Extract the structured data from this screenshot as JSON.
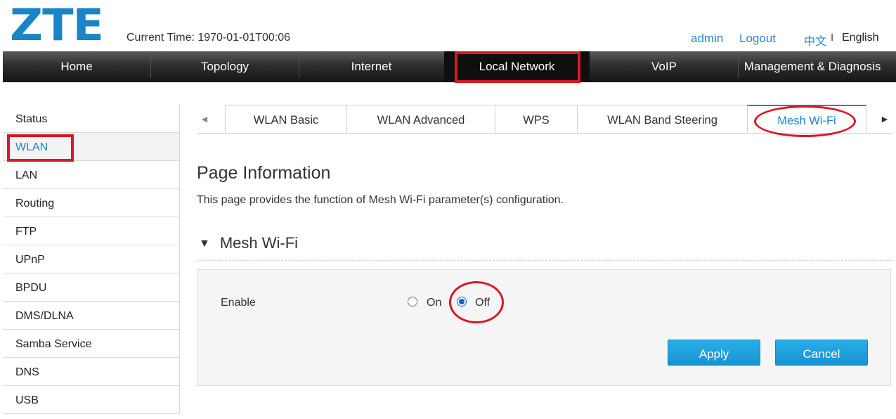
{
  "brand": {
    "logo": "ZTE",
    "color": "#1a84c7"
  },
  "header": {
    "current_time": "Current Time: 1970-01-01T00:06",
    "user": "admin",
    "logout": "Logout",
    "lang_cn": "中文",
    "lang_sep": "I",
    "lang_en": "English"
  },
  "nav": {
    "items": [
      {
        "label": "Home"
      },
      {
        "label": "Topology"
      },
      {
        "label": "Internet"
      },
      {
        "label": "Local Network",
        "active": true
      },
      {
        "label": "VoIP"
      },
      {
        "label": "Management & Diagnosis"
      }
    ]
  },
  "sidebar": {
    "items": [
      {
        "label": "Status"
      },
      {
        "label": "WLAN",
        "active": true
      },
      {
        "label": "LAN"
      },
      {
        "label": "Routing"
      },
      {
        "label": "FTP"
      },
      {
        "label": "UPnP"
      },
      {
        "label": "BPDU"
      },
      {
        "label": "DMS/DLNA"
      },
      {
        "label": "Samba Service"
      },
      {
        "label": "DNS"
      },
      {
        "label": "USB"
      }
    ]
  },
  "tabs": {
    "left_arrow": "◄",
    "right_arrow": "►",
    "items": [
      {
        "label": "WLAN Basic"
      },
      {
        "label": "WLAN Advanced"
      },
      {
        "label": "WPS"
      },
      {
        "label": "WLAN Band Steering"
      },
      {
        "label": "Mesh Wi-Fi",
        "active": true
      }
    ]
  },
  "main": {
    "page_title": "Page Information",
    "page_desc": "This page provides the function of Mesh Wi-Fi parameter(s) configuration.",
    "section_title": "Mesh Wi-Fi",
    "section_icon": "triangle-down-icon",
    "enable_label": "Enable",
    "radio_on": "On",
    "radio_off": "Off",
    "selected": "Off",
    "apply": "Apply",
    "cancel": "Cancel"
  },
  "colors": {
    "accent": "#1a84c7",
    "highlight": "#d71924",
    "button": "#1793d3"
  }
}
